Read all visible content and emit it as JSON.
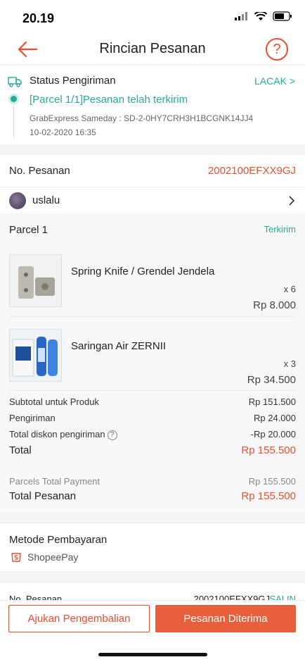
{
  "status_bar": {
    "time": "20.19"
  },
  "header": {
    "title": "Rincian Pesanan",
    "help_icon": "?"
  },
  "shipping": {
    "title": "Status Pengiriman",
    "track_label": "LACAK >",
    "status": "[Parcel 1/1]Pesanan telah terkirim",
    "courier": "GrabExpress Sameday :  SD-2-0HY7CRH3H1BCGNK14JJ4",
    "datetime": "10-02-2020 16:35"
  },
  "order": {
    "label": "No. Pesanan",
    "number": "2002100EFXX9GJ"
  },
  "shop": {
    "name": "uslalu"
  },
  "parcel": {
    "label": "Parcel 1",
    "status": "Terkirim"
  },
  "products": [
    {
      "name": "Spring Knife / Grendel Jendela",
      "qty": "x 6",
      "price": "Rp 8.000"
    },
    {
      "name": "Saringan Air ZERNII",
      "qty": "x 3",
      "price": "Rp 34.500"
    }
  ],
  "summary": {
    "subtotal_label": "Subtotal untuk Produk",
    "subtotal": "Rp 151.500",
    "shipping_label": "Pengiriman",
    "shipping": "Rp 24.000",
    "discount_label": "Total diskon pengiriman",
    "discount": "-Rp 20.000",
    "total_label": "Total",
    "total": "Rp 155.500"
  },
  "payment_totals": {
    "parcels_label": "Parcels Total Payment",
    "parcels_value": "Rp 155.500",
    "total_label": "Total Pesanan",
    "total_value": "Rp 155.500"
  },
  "payment_method": {
    "title": "Metode Pembayaran",
    "method": "ShopeePay"
  },
  "order_repeat": {
    "label": "No. Pesanan",
    "number": "2002100EFXX9GJ",
    "copy": "SALIN"
  },
  "actions": {
    "return_label": "Ajukan Pengembalian",
    "received_label": "Pesanan Diterima"
  },
  "colors": {
    "accent": "#ee4d2d",
    "teal": "#26aa99"
  }
}
